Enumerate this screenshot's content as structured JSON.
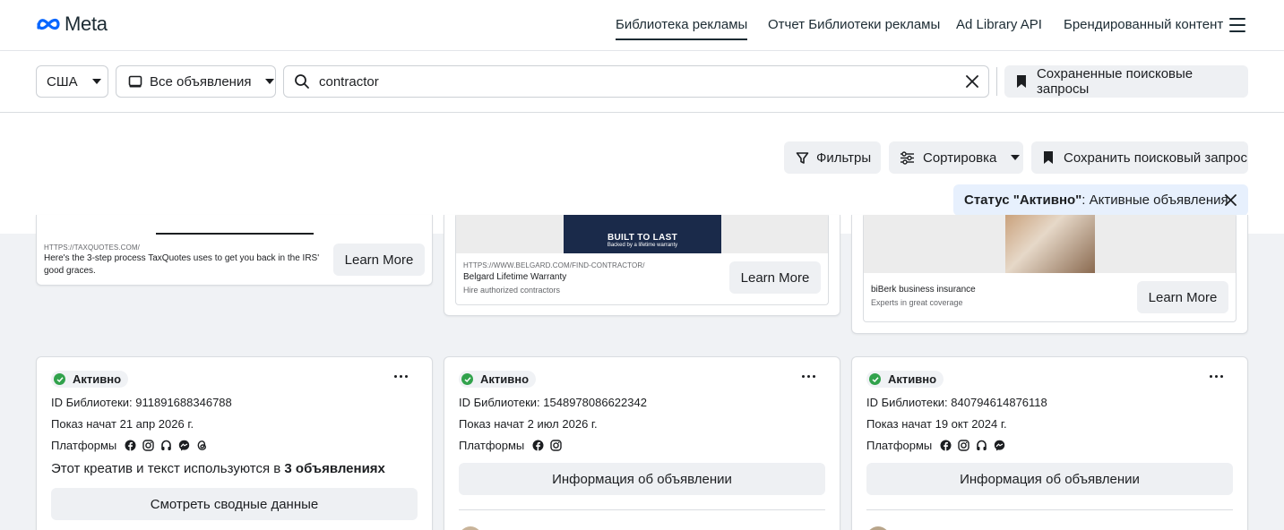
{
  "nav": {
    "logo": "Meta",
    "links": [
      "Библиотека рекламы",
      "Отчет Библиотеки рекламы",
      "Ad Library API",
      "Брендированный контент"
    ]
  },
  "search": {
    "country": "США",
    "ad_type": "Все объявления",
    "query": "contractor",
    "saved_searches": "Сохраненные поисковые запросы"
  },
  "controls": {
    "filters": "Фильтры",
    "sort": "Сортировка",
    "save_search": "Сохранить поисковый запрос",
    "status_bold": "Статус \"Активно\"",
    "status_rest": ": Активные объявления"
  },
  "top_cards": [
    {
      "url": "HTTPS://TAXQUOTES.COM/",
      "title": "Here's the 3-step process TaxQuotes uses to get you back in the IRS' good graces.",
      "cta": "Learn More"
    },
    {
      "url": "HTTPS://WWW.BELGARD.COM/FIND-CONTRACTOR/",
      "title": "Belgard Lifetime Warranty",
      "sub": "Hire authorized contractors",
      "banner_title": "BUILT TO LAST",
      "banner_sub": "Backed by a lifetime warranty",
      "cta": "Learn More"
    },
    {
      "title": "biBerk business insurance",
      "sub": "Experts in great coverage",
      "cta": "Learn More"
    }
  ],
  "cards": [
    {
      "status": "Активно",
      "library_id": "ID Библиотеки: 911891688346788",
      "started": "Показ начат 21 апр 2026 г.",
      "platforms_label": "Платформы",
      "creative_prefix": "Этот креатив и текст используются в ",
      "creative_bold": "3 объявлениях",
      "button": "Смотреть сводные данные"
    },
    {
      "status": "Активно",
      "library_id": "ID Библиотеки: 1548978086622342",
      "started": "Показ начат 2 июл 2026 г.",
      "platforms_label": "Платформы",
      "button": "Информация об объявлении"
    },
    {
      "status": "Активно",
      "library_id": "ID Библиотеки: 840794614876118",
      "started": "Показ начат 19 окт 2024 г.",
      "platforms_label": "Платформы",
      "button": "Информация об объявлении"
    }
  ],
  "colors": {
    "accent": "#1877f2",
    "active_green": "#31a24c",
    "chip_bg": "#e7f0fd",
    "button_bg": "#eef0f3"
  }
}
